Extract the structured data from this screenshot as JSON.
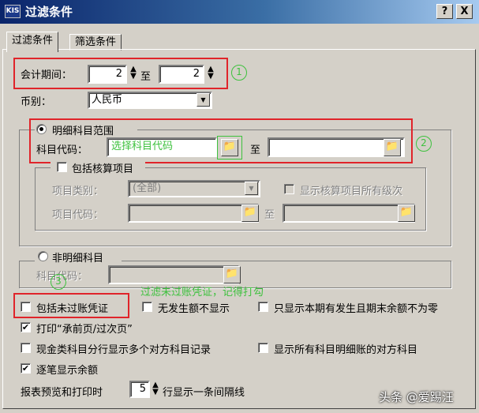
{
  "window": {
    "title": "过滤条件",
    "app_icon": "KIS",
    "help_label": "?",
    "close_label": "X"
  },
  "tabs": [
    "过滤条件",
    "筛选条件"
  ],
  "period": {
    "label": "会计期间：",
    "from": "2",
    "to_label": "至",
    "to": "2"
  },
  "currency": {
    "label": "币别：",
    "value": "人民币"
  },
  "detail": {
    "radio_label": "明细科目范围",
    "code_label": "科目代码：",
    "code_placeholder": "选择科目代码",
    "to_label": "至"
  },
  "accounting": {
    "check_label": "包括核算项目",
    "category_label": "项目类别：",
    "category_value": "(全部)",
    "show_all_levels_label": "显示核算项目所有级次",
    "code_label": "项目代码：",
    "to_label": "至"
  },
  "non_detail": {
    "radio_label": "非明细科目",
    "code_label": "科目代码："
  },
  "annotations": {
    "num1": "1",
    "num2": "2",
    "num3": "3",
    "note": "过滤未过账凭证，记得打勾"
  },
  "options": {
    "include_unposted": "包括未过账凭证",
    "hide_zero": "无发生额不显示",
    "only_period_balance": "只显示本期有发生且期末余额不为零",
    "print_carry": "打印“承前页/过次页”",
    "cash_multi_line": "现金类科目分行显示多个对方科目记录",
    "show_all_detail_counter": "显示所有科目明细账的对方科目",
    "running_balance": "逐笔显示余额"
  },
  "preview": {
    "label_before": "报表预览和打印时",
    "value": "5",
    "label_after": "行显示一条间隔线"
  },
  "watermark": "头条 @爱踢汪"
}
